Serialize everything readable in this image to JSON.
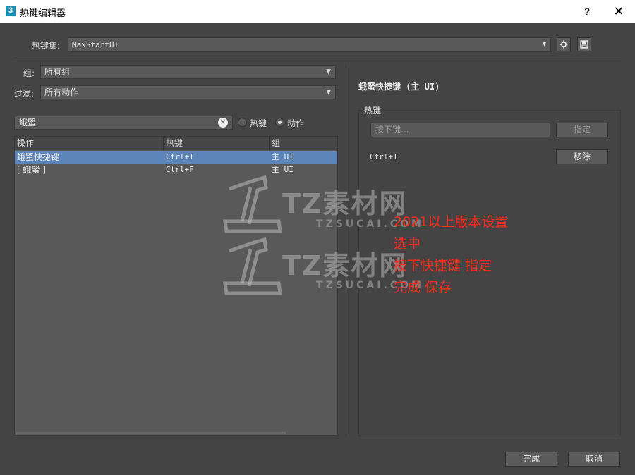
{
  "window": {
    "title": "热键编辑器",
    "app_icon": "3",
    "help": "?",
    "close": "✕"
  },
  "hotkey_set": {
    "label": "热键集:",
    "value": "MaxStartUI",
    "settings_icon": "gear-icon",
    "save_icon": "save-icon"
  },
  "group_filter": {
    "label": "组:",
    "value": "所有组"
  },
  "action_filter": {
    "label": "过滤:",
    "value": "所有动作"
  },
  "search": {
    "value": "蛾蜸",
    "clear": "✕"
  },
  "search_mode": {
    "hotkey_label": "热键",
    "action_label": "动作",
    "selected": "action"
  },
  "table": {
    "columns": [
      "操作",
      "热键",
      "组"
    ],
    "rows": [
      {
        "action": "蛾蜸快捷键",
        "hotkey": "Ctrl+T",
        "group": "主 UI",
        "selected": true
      },
      {
        "action": "[ 蛾蜸 ]",
        "hotkey": "Ctrl+F",
        "group": "主 UI",
        "selected": false
      }
    ]
  },
  "detail": {
    "title": "蛾蜸快捷键 (主 UI)",
    "group_label": "热键",
    "input_placeholder": "按下键...",
    "assign_label": "指定",
    "current_hotkey": "Ctrl+T",
    "remove_label": "移除"
  },
  "annotation": {
    "lines": [
      "2021以上版本设置",
      "选中",
      "按下快捷键 指定",
      "完成 保存"
    ],
    "color": "#ff2a1a"
  },
  "watermark": {
    "brand": "TZ素材网",
    "domain": "TZSUCAI.COM"
  },
  "footer": {
    "done_label": "完成",
    "cancel_label": "取消"
  }
}
